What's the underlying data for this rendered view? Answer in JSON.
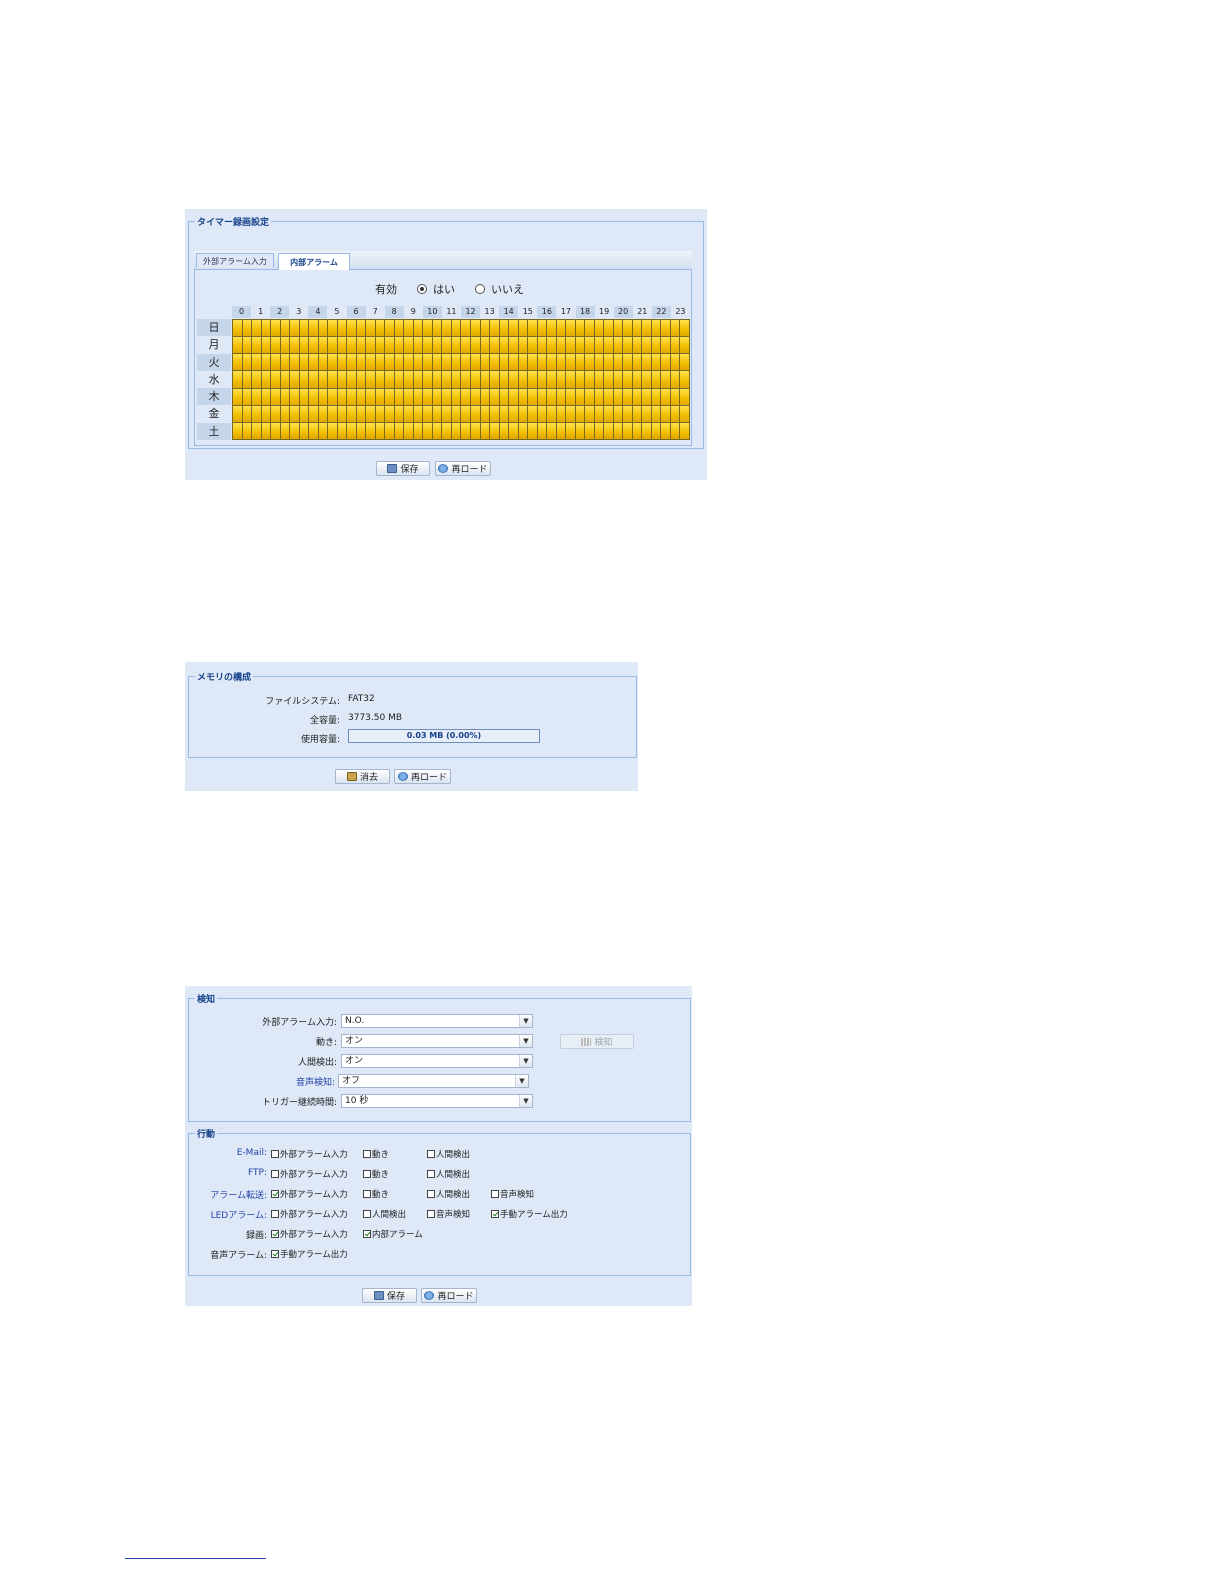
{
  "schedule": {
    "legend": "タイマー録画設定",
    "tabs": [
      "外部アラーム入力",
      "内部アラーム"
    ],
    "enable_label": "有効",
    "yes_label": "はい",
    "no_label": "いいえ",
    "selected": "はい",
    "hours": [
      "0",
      "1",
      "2",
      "3",
      "4",
      "5",
      "6",
      "7",
      "8",
      "9",
      "10",
      "11",
      "12",
      "13",
      "14",
      "15",
      "16",
      "17",
      "18",
      "19",
      "20",
      "21",
      "22",
      "23"
    ],
    "days": [
      "日",
      "月",
      "火",
      "水",
      "木",
      "金",
      "土"
    ],
    "all_slots_active": true,
    "slot_color": "#f1bd00",
    "save_label": "保存",
    "reload_label": "再ロード"
  },
  "memory": {
    "legend": "メモリの構成",
    "fs_label": "ファイルシステム:",
    "fs_value": "FAT32",
    "total_label": "全容量:",
    "total_value": "3773.50 MB",
    "used_label": "使用容量:",
    "used_value": "0.03 MB (0.00%)",
    "used_fraction": 0.0,
    "format_label": "消去",
    "reload_label": "再ロード"
  },
  "event": {
    "detect_legend": "検知",
    "fields": [
      {
        "label": "外部アラーム入力:",
        "value": "N.O."
      },
      {
        "label": "動き:",
        "value": "オン"
      },
      {
        "label": "人間検出:",
        "value": "オン"
      },
      {
        "label": "音声検知:",
        "value": "オフ"
      },
      {
        "label": "トリガー継続時間:",
        "value": "10 秒"
      }
    ],
    "detect_button": "検知",
    "action_legend": "行動",
    "actions": [
      {
        "label": "E-Mail:",
        "options": [
          {
            "text": "外部アラーム入力",
            "checked": false
          },
          {
            "text": "動き",
            "checked": false
          },
          {
            "text": "人間検出",
            "checked": false
          }
        ]
      },
      {
        "label": "FTP:",
        "options": [
          {
            "text": "外部アラーム入力",
            "checked": false
          },
          {
            "text": "動き",
            "checked": false
          },
          {
            "text": "人間検出",
            "checked": false
          }
        ]
      },
      {
        "label": "アラーム転送:",
        "options": [
          {
            "text": "外部アラーム入力",
            "checked": true
          },
          {
            "text": "動き",
            "checked": false
          },
          {
            "text": "人間検出",
            "checked": false
          },
          {
            "text": "音声検知",
            "checked": false
          }
        ]
      },
      {
        "label": "LEDアラーム:",
        "options": [
          {
            "text": "外部アラーム入力",
            "checked": false
          },
          {
            "text": "人間検出",
            "checked": false
          },
          {
            "text": "音声検知",
            "checked": false
          },
          {
            "text": "手動アラーム出力",
            "checked": true
          }
        ]
      },
      {
        "label": "録画:",
        "options": [
          {
            "text": "外部アラーム入力",
            "checked": true
          },
          {
            "text": "内部アラーム",
            "checked": true
          }
        ]
      },
      {
        "label": "音声アラーム:",
        "options": [
          {
            "text": "手動アラーム出力",
            "checked": true
          }
        ]
      }
    ],
    "save_label": "保存",
    "reload_label": "再ロード"
  },
  "colors": {
    "panel_bg": "#dfe8f6",
    "border": "#99bbe8",
    "legend_text": "#15428b",
    "link_blue": "#2244aa"
  }
}
